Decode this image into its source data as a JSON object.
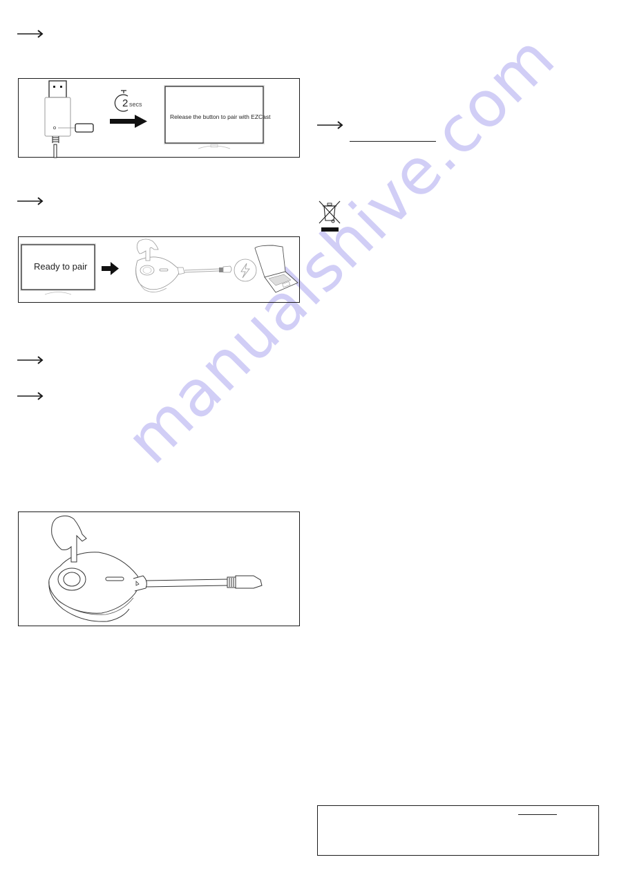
{
  "page": {
    "background": "#ffffff",
    "ink_color": "#1a1a1a",
    "watermark": {
      "text": "manualshive.com",
      "color": "#c9c6f5"
    }
  },
  "left_column": {
    "notes": [
      {
        "icon": "note-arrow-icon"
      },
      {
        "icon": "note-arrow-icon"
      },
      {
        "icon": "note-arrow-icon"
      },
      {
        "icon": "note-arrow-icon"
      }
    ],
    "figure_1": {
      "timer_number": "2",
      "timer_unit": "secs",
      "screen_message": "Release the button to pair with EZCast"
    },
    "figure_2": {
      "screen_message": "Ready to pair"
    },
    "figure_3": {}
  },
  "right_column": {
    "notes": [
      {
        "icon": "note-arrow-icon"
      }
    ],
    "disposal_icon": "weee-crossed-bin-icon"
  }
}
